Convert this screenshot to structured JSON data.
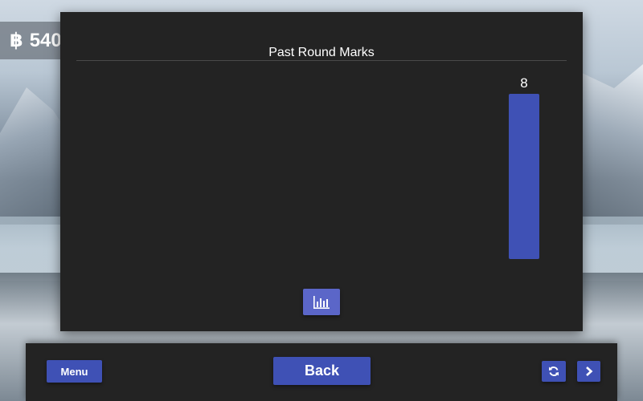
{
  "currency": {
    "icon": "bitcoin-icon",
    "symbol": "฿",
    "amount": "540"
  },
  "modal": {
    "title": "Past Round Marks"
  },
  "chart_data": {
    "type": "bar",
    "title": "Past Round Marks",
    "categories": [
      ""
    ],
    "values": [
      8
    ],
    "data_labels": [
      "8"
    ],
    "ylim": [
      0,
      8
    ],
    "grid": false,
    "color": "#3f51b5"
  },
  "chart_button": {
    "icon": "bar-chart-icon"
  },
  "bottombar": {
    "menu_label": "Menu",
    "back_label": "Back",
    "refresh_icon": "refresh-icon",
    "next_icon": "chevron-right-icon"
  },
  "colors": {
    "panel": "#232323",
    "accent": "#3f51b5",
    "chart_button": "#5b66c8"
  }
}
